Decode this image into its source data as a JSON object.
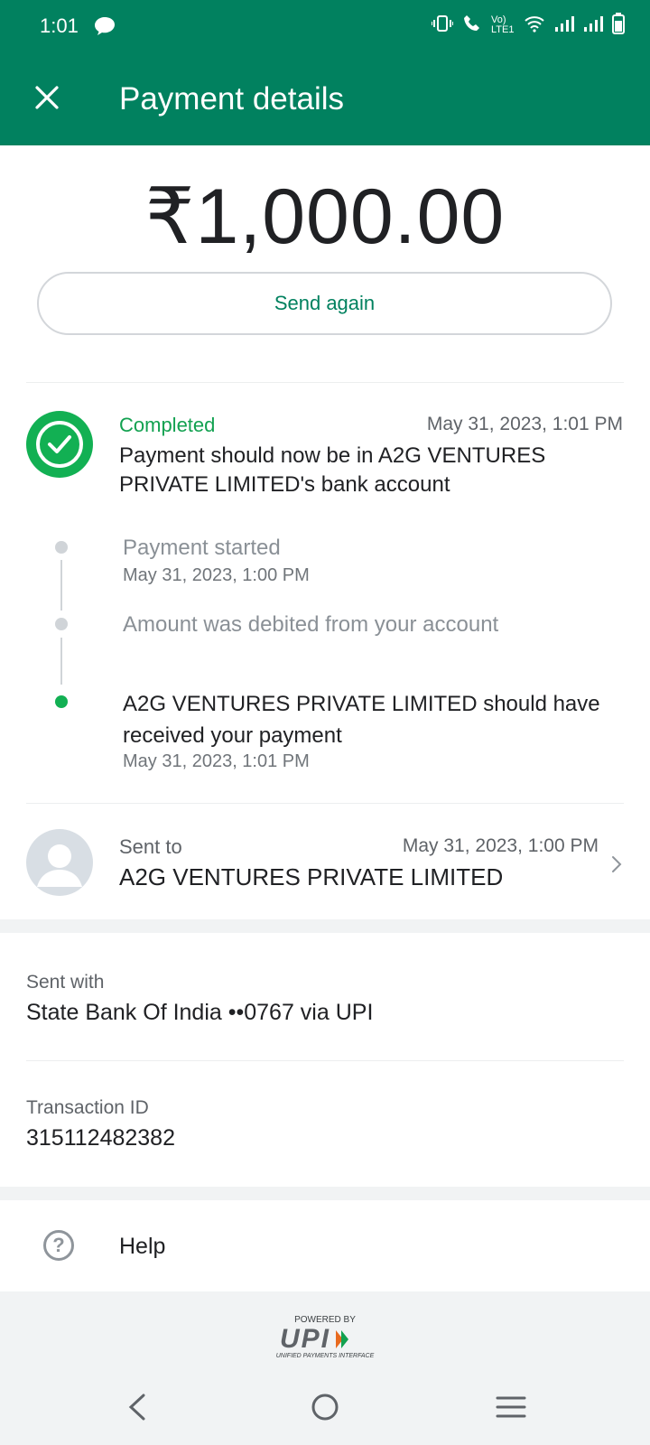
{
  "status_bar": {
    "time": "1:01",
    "network_label": "Vo) LTE1"
  },
  "header": {
    "title": "Payment details"
  },
  "payment": {
    "amount": "₹1,000.00",
    "send_again_label": "Send again"
  },
  "status": {
    "state": "Completed",
    "time": "May 31, 2023, 1:01 PM",
    "message": "Payment should now be in A2G VENTURES PRIVATE LIMITED's bank account"
  },
  "timeline": [
    {
      "title": "Payment started",
      "time": "May 31, 2023, 1:00 PM"
    },
    {
      "title": "Amount was debited from your account",
      "time": ""
    },
    {
      "title": "A2G VENTURES PRIVATE LIMITED should have received your payment",
      "time": "May 31, 2023, 1:01 PM"
    }
  ],
  "sent_to": {
    "label": "Sent to",
    "time": "May 31, 2023, 1:00 PM",
    "name": "A2G VENTURES PRIVATE LIMITED"
  },
  "sent_with": {
    "label": "Sent with",
    "value": "State Bank Of India ••0767 via UPI"
  },
  "transaction": {
    "label": "Transaction ID",
    "value": "315112482382"
  },
  "help": {
    "label": "Help"
  },
  "footer": {
    "powered_by": "POWERED BY",
    "upi_logo": "UPI",
    "upi_sub": "UNIFIED PAYMENTS INTERFACE"
  },
  "colors": {
    "brand_green": "#01815f",
    "success_green": "#12b053"
  }
}
